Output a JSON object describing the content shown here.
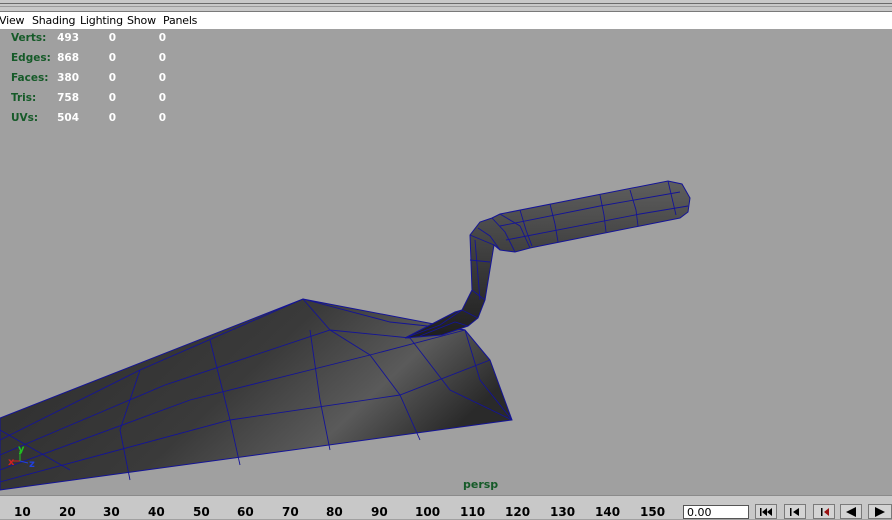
{
  "menu": [
    {
      "id": "view",
      "label": "View"
    },
    {
      "id": "shading",
      "label": "Shading"
    },
    {
      "id": "lighting",
      "label": "Lighting"
    },
    {
      "id": "show",
      "label": "Show"
    },
    {
      "id": "panels",
      "label": "Panels"
    }
  ],
  "hud": {
    "rows": [
      {
        "label": "Verts:",
        "v1": "493",
        "v2": "0",
        "v3": "0"
      },
      {
        "label": "Edges:",
        "v1": "868",
        "v2": "0",
        "v3": "0"
      },
      {
        "label": "Faces:",
        "v1": "380",
        "v2": "0",
        "v3": "0"
      },
      {
        "label": "Tris:",
        "v1": "758",
        "v2": "0",
        "v3": "0"
      },
      {
        "label": "UVs:",
        "v1": "504",
        "v2": "0",
        "v3": "0"
      }
    ]
  },
  "viewport": {
    "camera_label": "persp",
    "axes": {
      "x": "x",
      "y": "y",
      "z": "z"
    }
  },
  "timeline": {
    "ticks": [
      "10",
      "20",
      "30",
      "40",
      "50",
      "60",
      "70",
      "80",
      "90",
      "100",
      "110",
      "120",
      "130",
      "140",
      "150"
    ],
    "current_time": "0.00",
    "buttons": [
      "go-to-start-icon",
      "step-back-key-icon",
      "step-back-frame-icon",
      "play-backwards-icon",
      "play-forwards-icon"
    ]
  },
  "colors": {
    "wire": "#141496",
    "hud_label": "#155a28",
    "viewport_bg": "#a0a0a0"
  }
}
